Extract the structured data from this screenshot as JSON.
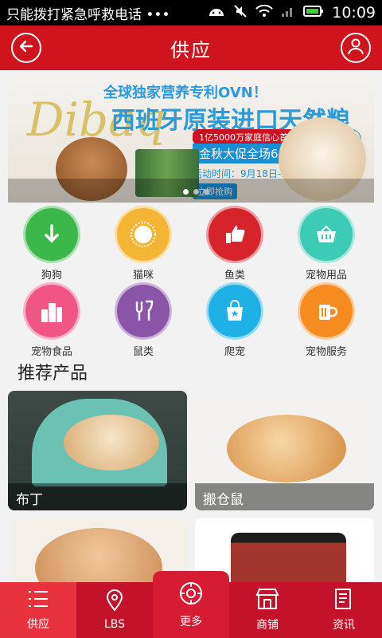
{
  "status_bar": {
    "carrier_text": "只能拨打紧急呼救电话 •••",
    "time": "10:09"
  },
  "header": {
    "title": "供应"
  },
  "banner": {
    "brand": "Dibaq",
    "slogan": "全球独家营养专利OVN！",
    "headline": "西班牙原装进口天然粮",
    "tagline": "1亿5000万家庭信心首选",
    "sale": "金秋大促全场6.8折",
    "period": "活动时间：9月18日-9月30日",
    "cta": "立即抢购",
    "corner": "包邮"
  },
  "categories": [
    {
      "label": "狗狗",
      "color": "#3cb84a",
      "icon": "download-arrow-icon"
    },
    {
      "label": "猫咪",
      "color": "#f4b534",
      "icon": "sun-icon"
    },
    {
      "label": "鱼类",
      "color": "#d6232c",
      "icon": "thumbs-up-icon"
    },
    {
      "label": "宠物用品",
      "color": "#3ccbb5",
      "icon": "basket-icon"
    },
    {
      "label": "宠物食品",
      "color": "#f05585",
      "icon": "buildings-icon"
    },
    {
      "label": "鼠类",
      "color": "#8a54a8",
      "icon": "cutlery-icon"
    },
    {
      "label": "爬宠",
      "color": "#1fb1e6",
      "icon": "shopping-bag-icon"
    },
    {
      "label": "宠物服务",
      "color": "#f68c1f",
      "icon": "beer-mug-icon"
    }
  ],
  "section_title": "推荐产品",
  "products": [
    {
      "label": "布丁"
    },
    {
      "label": "搬仓鼠"
    },
    {
      "label": ""
    },
    {
      "label": ""
    }
  ],
  "tabbar": [
    {
      "label": "供应",
      "icon": "list-icon"
    },
    {
      "label": "LBS",
      "icon": "location-pin-icon"
    },
    {
      "label": "更多",
      "icon": "gear-flower-icon"
    },
    {
      "label": "商铺",
      "icon": "storefront-icon"
    },
    {
      "label": "资讯",
      "icon": "document-icon"
    }
  ]
}
